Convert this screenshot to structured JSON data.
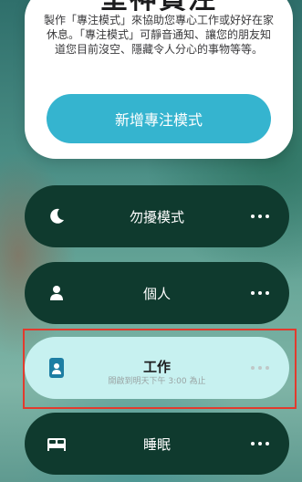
{
  "card": {
    "title": "呈神貫注",
    "description": "製作「專注模式」來協助您專心工作或好好在家休息。「專注模式」可靜音通知、讓您的朋友知道您目前沒空、隱藏令人分心的事物等等。",
    "add_button": "新增專注模式"
  },
  "modes": [
    {
      "label": "勿擾模式",
      "icon": "moon-icon"
    },
    {
      "label": "個人",
      "icon": "person-icon"
    },
    {
      "label": "工作",
      "icon": "work-badge-icon",
      "subtitle": "開啟到明天下午 3:00 為止",
      "active": true
    },
    {
      "label": "睡眠",
      "icon": "bed-icon"
    }
  ],
  "colors": {
    "accent": "#35b4cf",
    "mode_dark_bg": "#0f3a2e",
    "mode_active_bg": "#c7f1f0",
    "highlight_border": "#e23b2e"
  }
}
